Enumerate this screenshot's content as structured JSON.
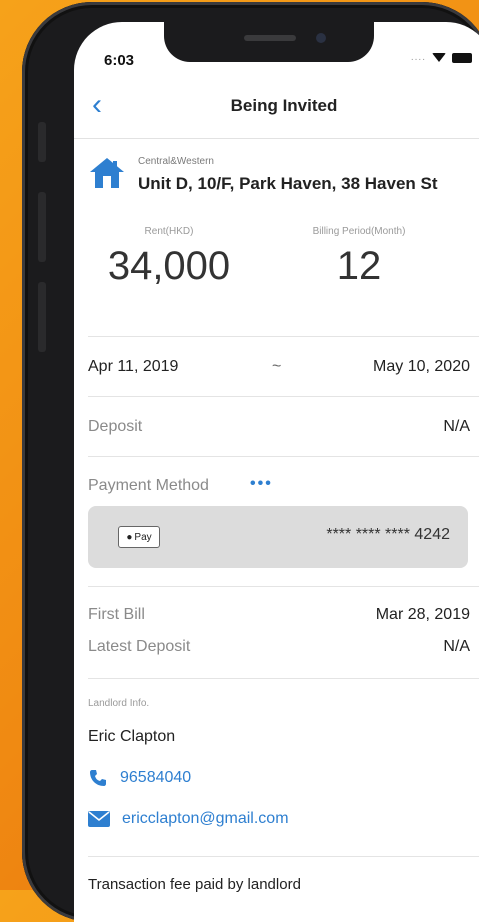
{
  "status_bar": {
    "time": "6:03",
    "signal": "...."
  },
  "nav": {
    "back_symbol": "‹",
    "title": "Being Invited"
  },
  "property": {
    "district": "Central&Western",
    "address": "Unit D, 10/F, Park Haven, 38 Haven St",
    "icon": "house-icon"
  },
  "rent": {
    "label": "Rent(HKD)",
    "value": "34,000"
  },
  "billing": {
    "label": "Billing Period(Month)",
    "value": "12"
  },
  "dates": {
    "start": "Apr 11, 2019",
    "separator": "~",
    "end": "May 10, 2020"
  },
  "deposit": {
    "label": "Deposit",
    "value": "N/A"
  },
  "payment": {
    "label": "Payment Method",
    "more": "•••",
    "card_brand": "Pay",
    "card_number": "**** **** **** 4242"
  },
  "first_bill": {
    "label": "First Bill",
    "value": "Mar 28, 2019"
  },
  "latest_deposit": {
    "label": "Latest Deposit",
    "value": "N/A"
  },
  "landlord": {
    "section_label": "Landlord Info.",
    "name": "Eric Clapton",
    "phone": "96584040",
    "email": "ericclapton@gmail.com"
  },
  "footer": {
    "text": "Transaction fee paid by landlord"
  },
  "colors": {
    "accent": "#2e7fd0",
    "background": "#f29016",
    "card": "#dcdcdc"
  }
}
